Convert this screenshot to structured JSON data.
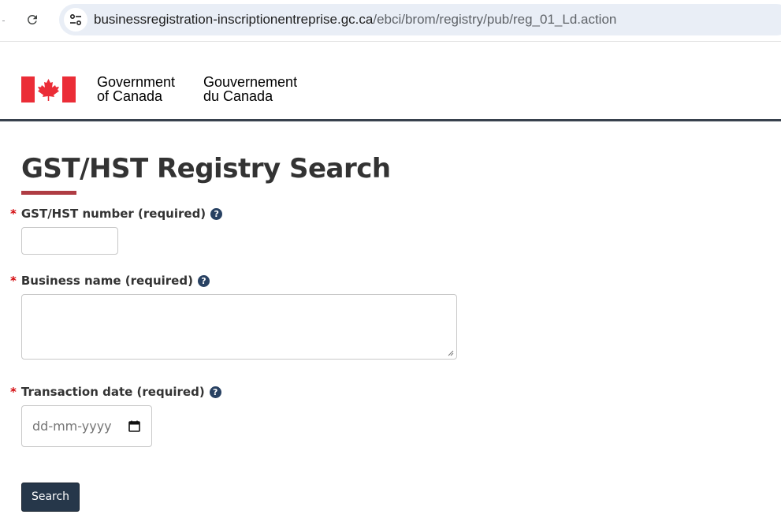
{
  "browser": {
    "url_domain": "businessregistration-inscriptionentreprise.gc.ca",
    "url_path": "/ebci/brom/registry/pub/reg_01_Ld.action"
  },
  "header": {
    "signature_en_line1": "Government",
    "signature_en_line2": "of Canada",
    "signature_fr_line1": "Gouvernement",
    "signature_fr_line2": "du Canada"
  },
  "main": {
    "title": "GST/HST Registry Search",
    "fields": [
      {
        "label": "GST/HST number (required)",
        "required_mark": "*",
        "value": ""
      },
      {
        "label": "Business name (required)",
        "required_mark": "*",
        "value": ""
      },
      {
        "label": "Transaction date (required)",
        "required_mark": "*",
        "placeholder": "dd-mm-yyyy"
      }
    ],
    "search_button": "Search"
  },
  "colors": {
    "accent_bar": "#af3c43",
    "button": "#26374a",
    "help_icon": "#284162",
    "required": "#d3080c",
    "header_rule": "#38414d",
    "flag_red": "#eb2d37"
  },
  "icons": [
    "reload-icon",
    "site-info-icon",
    "canada-flag-icon",
    "help-icon",
    "calendar-icon"
  ]
}
